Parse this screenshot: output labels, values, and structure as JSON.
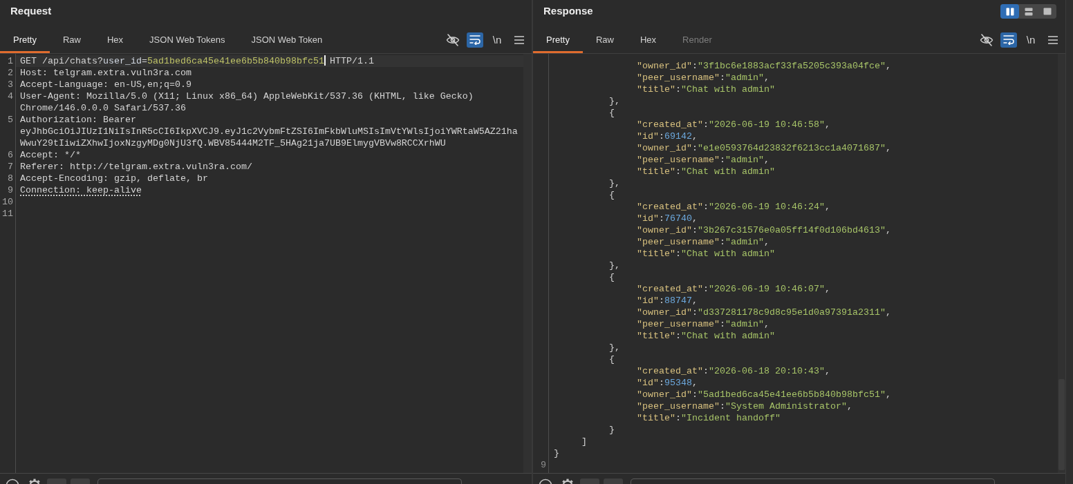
{
  "request": {
    "title": "Request",
    "tabs": [
      {
        "label": "Pretty",
        "selected": true,
        "disabled": false
      },
      {
        "label": "Raw",
        "selected": false,
        "disabled": false
      },
      {
        "label": "Hex",
        "selected": false,
        "disabled": false
      },
      {
        "label": "JSON Web Tokens",
        "selected": false,
        "disabled": false
      },
      {
        "label": "JSON Web Token",
        "selected": false,
        "disabled": false
      }
    ],
    "toolbar": [
      {
        "kind": "eye-off",
        "active": false
      },
      {
        "kind": "wrap",
        "active": true
      },
      {
        "kind": "text",
        "label": "\\n",
        "active": false
      },
      {
        "kind": "menu",
        "active": false
      }
    ],
    "editor": {
      "lines": [
        {
          "number": "1",
          "tokens": [
            {
              "kind": "plain",
              "text": "GET /api/chats?"
            },
            {
              "kind": "param",
              "text": "user_id"
            },
            {
              "kind": "plain",
              "text": "="
            },
            {
              "kind": "value",
              "text": "5ad1bed6ca45e41ee6b5b840b98bfc51"
            },
            {
              "kind": "cursor"
            },
            {
              "kind": "plain",
              "text": " HTTP/1.1"
            }
          ]
        },
        {
          "number": "2",
          "tokens": [
            {
              "kind": "plain",
              "text": "Host: telgram.extra.vuln3ra.com"
            }
          ]
        },
        {
          "number": "3",
          "tokens": [
            {
              "kind": "plain",
              "text": "Accept-Language: en-US,en;q=0.9"
            }
          ]
        },
        {
          "number": "4",
          "tokens": [
            {
              "kind": "plain",
              "text": "User-Agent: Mozilla/5.0 (X11; Linux x86_64) AppleWebKit/537.36 (KHTML, like Gecko) Chrome/146.0.0.0 Safari/537.36"
            }
          ]
        },
        {
          "number": "5",
          "tokens": [
            {
              "kind": "plain",
              "text": "Authorization: Bearer eyJhbGciOiJIUzI1NiIsInR5cCI6IkpXVCJ9.eyJ1c2VybmFtZSI6ImFkbWluMSIsImVtYWlsIjoiYWRtaW5AZ21haWwuY29tIiwiZXhwIjoxNzgyMDg0NjU3fQ.WBV85444M2TF_5HAg21ja7UB9ElmygVBVw8RCCXrhWU"
            }
          ]
        },
        {
          "number": "6",
          "tokens": [
            {
              "kind": "plain",
              "text": "Accept: */*"
            }
          ]
        },
        {
          "number": "7",
          "tokens": [
            {
              "kind": "plain",
              "text": "Referer: http://telgram.extra.vuln3ra.com/"
            }
          ]
        },
        {
          "number": "8",
          "tokens": [
            {
              "kind": "plain",
              "text": "Accept-Encoding: gzip, deflate, br"
            }
          ]
        },
        {
          "number": "9",
          "tokens": [
            {
              "kind": "hint",
              "text": "Connection: keep-alive"
            }
          ]
        },
        {
          "number": "10"
        },
        {
          "number": "11"
        }
      ]
    }
  },
  "response": {
    "title": "Response",
    "layouts": [
      {
        "kind": "columns",
        "selected": true
      },
      {
        "kind": "rows",
        "selected": false
      },
      {
        "kind": "single",
        "selected": false
      }
    ],
    "tabs": [
      {
        "label": "Pretty",
        "selected": true,
        "disabled": false
      },
      {
        "label": "Raw",
        "selected": false,
        "disabled": false
      },
      {
        "label": "Hex",
        "selected": false,
        "disabled": false
      },
      {
        "label": "Render",
        "selected": false,
        "disabled": true
      }
    ],
    "toolbar": [
      {
        "kind": "eye-off",
        "active": false
      },
      {
        "kind": "wrap",
        "active": true
      },
      {
        "kind": "text",
        "label": "\\n",
        "active": false
      },
      {
        "kind": "menu",
        "active": false
      }
    ],
    "editor": {
      "body": {
        "kind": "block",
        "close": "}",
        "children": [
          {
            "kind": "block",
            "close": "]",
            "children": [
              {
                "kind": "block",
                "close": "},",
                "children": [
                  {
                    "kind": "field",
                    "tokens": [
                      {
                        "kind": "key",
                        "text": "\"owner_id\""
                      },
                      {
                        "kind": "punct",
                        "text": ":"
                      },
                      {
                        "kind": "string",
                        "text": "\"3f1bc6e1883acf33fa5205c393a04fce\""
                      },
                      {
                        "kind": "punct",
                        "text": ","
                      }
                    ]
                  },
                  {
                    "kind": "field",
                    "tokens": [
                      {
                        "kind": "key",
                        "text": "\"peer_username\""
                      },
                      {
                        "kind": "punct",
                        "text": ":"
                      },
                      {
                        "kind": "string",
                        "text": "\"admin\""
                      },
                      {
                        "kind": "punct",
                        "text": ","
                      }
                    ]
                  },
                  {
                    "kind": "field",
                    "tokens": [
                      {
                        "kind": "key",
                        "text": "\"title\""
                      },
                      {
                        "kind": "punct",
                        "text": ":"
                      },
                      {
                        "kind": "string",
                        "text": "\"Chat with admin\""
                      }
                    ]
                  }
                ]
              },
              {
                "kind": "block",
                "open": "{",
                "close": "},",
                "children": [
                  {
                    "kind": "field",
                    "tokens": [
                      {
                        "kind": "key",
                        "text": "\"created_at\""
                      },
                      {
                        "kind": "punct",
                        "text": ":"
                      },
                      {
                        "kind": "string",
                        "text": "\"2026-06-19 10:46:58\""
                      },
                      {
                        "kind": "punct",
                        "text": ","
                      }
                    ]
                  },
                  {
                    "kind": "field",
                    "tokens": [
                      {
                        "kind": "key",
                        "text": "\"id\""
                      },
                      {
                        "kind": "punct",
                        "text": ":"
                      },
                      {
                        "kind": "number",
                        "text": "69142"
                      },
                      {
                        "kind": "punct",
                        "text": ","
                      }
                    ]
                  },
                  {
                    "kind": "field",
                    "tokens": [
                      {
                        "kind": "key",
                        "text": "\"owner_id\""
                      },
                      {
                        "kind": "punct",
                        "text": ":"
                      },
                      {
                        "kind": "string",
                        "text": "\"e1e0593764d23832f6213cc1a4071687\""
                      },
                      {
                        "kind": "punct",
                        "text": ","
                      }
                    ]
                  },
                  {
                    "kind": "field",
                    "tokens": [
                      {
                        "kind": "key",
                        "text": "\"peer_username\""
                      },
                      {
                        "kind": "punct",
                        "text": ":"
                      },
                      {
                        "kind": "string",
                        "text": "\"admin\""
                      },
                      {
                        "kind": "punct",
                        "text": ","
                      }
                    ]
                  },
                  {
                    "kind": "field",
                    "tokens": [
                      {
                        "kind": "key",
                        "text": "\"title\""
                      },
                      {
                        "kind": "punct",
                        "text": ":"
                      },
                      {
                        "kind": "string",
                        "text": "\"Chat with admin\""
                      }
                    ]
                  }
                ]
              },
              {
                "kind": "block",
                "open": "{",
                "close": "},",
                "children": [
                  {
                    "kind": "field",
                    "tokens": [
                      {
                        "kind": "key",
                        "text": "\"created_at\""
                      },
                      {
                        "kind": "punct",
                        "text": ":"
                      },
                      {
                        "kind": "string",
                        "text": "\"2026-06-19 10:46:24\""
                      },
                      {
                        "kind": "punct",
                        "text": ","
                      }
                    ]
                  },
                  {
                    "kind": "field",
                    "tokens": [
                      {
                        "kind": "key",
                        "text": "\"id\""
                      },
                      {
                        "kind": "punct",
                        "text": ":"
                      },
                      {
                        "kind": "number",
                        "text": "76740"
                      },
                      {
                        "kind": "punct",
                        "text": ","
                      }
                    ]
                  },
                  {
                    "kind": "field",
                    "tokens": [
                      {
                        "kind": "key",
                        "text": "\"owner_id\""
                      },
                      {
                        "kind": "punct",
                        "text": ":"
                      },
                      {
                        "kind": "string",
                        "text": "\"3b267c31576e0a05ff14f0d106bd4613\""
                      },
                      {
                        "kind": "punct",
                        "text": ","
                      }
                    ]
                  },
                  {
                    "kind": "field",
                    "tokens": [
                      {
                        "kind": "key",
                        "text": "\"peer_username\""
                      },
                      {
                        "kind": "punct",
                        "text": ":"
                      },
                      {
                        "kind": "string",
                        "text": "\"admin\""
                      },
                      {
                        "kind": "punct",
                        "text": ","
                      }
                    ]
                  },
                  {
                    "kind": "field",
                    "tokens": [
                      {
                        "kind": "key",
                        "text": "\"title\""
                      },
                      {
                        "kind": "punct",
                        "text": ":"
                      },
                      {
                        "kind": "string",
                        "text": "\"Chat with admin\""
                      }
                    ]
                  }
                ]
              },
              {
                "kind": "block",
                "open": "{",
                "close": "},",
                "children": [
                  {
                    "kind": "field",
                    "tokens": [
                      {
                        "kind": "key",
                        "text": "\"created_at\""
                      },
                      {
                        "kind": "punct",
                        "text": ":"
                      },
                      {
                        "kind": "string",
                        "text": "\"2026-06-19 10:46:07\""
                      },
                      {
                        "kind": "punct",
                        "text": ","
                      }
                    ]
                  },
                  {
                    "kind": "field",
                    "tokens": [
                      {
                        "kind": "key",
                        "text": "\"id\""
                      },
                      {
                        "kind": "punct",
                        "text": ":"
                      },
                      {
                        "kind": "number",
                        "text": "88747"
                      },
                      {
                        "kind": "punct",
                        "text": ","
                      }
                    ]
                  },
                  {
                    "kind": "field",
                    "tokens": [
                      {
                        "kind": "key",
                        "text": "\"owner_id\""
                      },
                      {
                        "kind": "punct",
                        "text": ":"
                      },
                      {
                        "kind": "string",
                        "text": "\"d337281178c9d8c95e1d0a97391a2311\""
                      },
                      {
                        "kind": "punct",
                        "text": ","
                      }
                    ]
                  },
                  {
                    "kind": "field",
                    "tokens": [
                      {
                        "kind": "key",
                        "text": "\"peer_username\""
                      },
                      {
                        "kind": "punct",
                        "text": ":"
                      },
                      {
                        "kind": "string",
                        "text": "\"admin\""
                      },
                      {
                        "kind": "punct",
                        "text": ","
                      }
                    ]
                  },
                  {
                    "kind": "field",
                    "tokens": [
                      {
                        "kind": "key",
                        "text": "\"title\""
                      },
                      {
                        "kind": "punct",
                        "text": ":"
                      },
                      {
                        "kind": "string",
                        "text": "\"Chat with admin\""
                      }
                    ]
                  }
                ]
              },
              {
                "kind": "block",
                "open": "{",
                "close": "}",
                "children": [
                  {
                    "kind": "field",
                    "tokens": [
                      {
                        "kind": "key",
                        "text": "\"created_at\""
                      },
                      {
                        "kind": "punct",
                        "text": ":"
                      },
                      {
                        "kind": "string",
                        "text": "\"2026-06-18 20:10:43\""
                      },
                      {
                        "kind": "punct",
                        "text": ","
                      }
                    ]
                  },
                  {
                    "kind": "field",
                    "tokens": [
                      {
                        "kind": "key",
                        "text": "\"id\""
                      },
                      {
                        "kind": "punct",
                        "text": ":"
                      },
                      {
                        "kind": "number",
                        "text": "95348"
                      },
                      {
                        "kind": "punct",
                        "text": ","
                      }
                    ]
                  },
                  {
                    "kind": "field",
                    "tokens": [
                      {
                        "kind": "key",
                        "text": "\"owner_id\""
                      },
                      {
                        "kind": "punct",
                        "text": ":"
                      },
                      {
                        "kind": "string",
                        "text": "\"5ad1bed6ca45e41ee6b5b840b98bfc51\""
                      },
                      {
                        "kind": "punct",
                        "text": ","
                      }
                    ]
                  },
                  {
                    "kind": "field",
                    "tokens": [
                      {
                        "kind": "key",
                        "text": "\"peer_username\""
                      },
                      {
                        "kind": "punct",
                        "text": ":"
                      },
                      {
                        "kind": "string",
                        "text": "\"System Administrator\""
                      },
                      {
                        "kind": "punct",
                        "text": ","
                      }
                    ]
                  },
                  {
                    "kind": "field",
                    "tokens": [
                      {
                        "kind": "key",
                        "text": "\"title\""
                      },
                      {
                        "kind": "punct",
                        "text": ":"
                      },
                      {
                        "kind": "string",
                        "text": "\"Incident handoff\""
                      }
                    ]
                  }
                ]
              }
            ]
          }
        ]
      },
      "end_line_number": "9"
    }
  }
}
